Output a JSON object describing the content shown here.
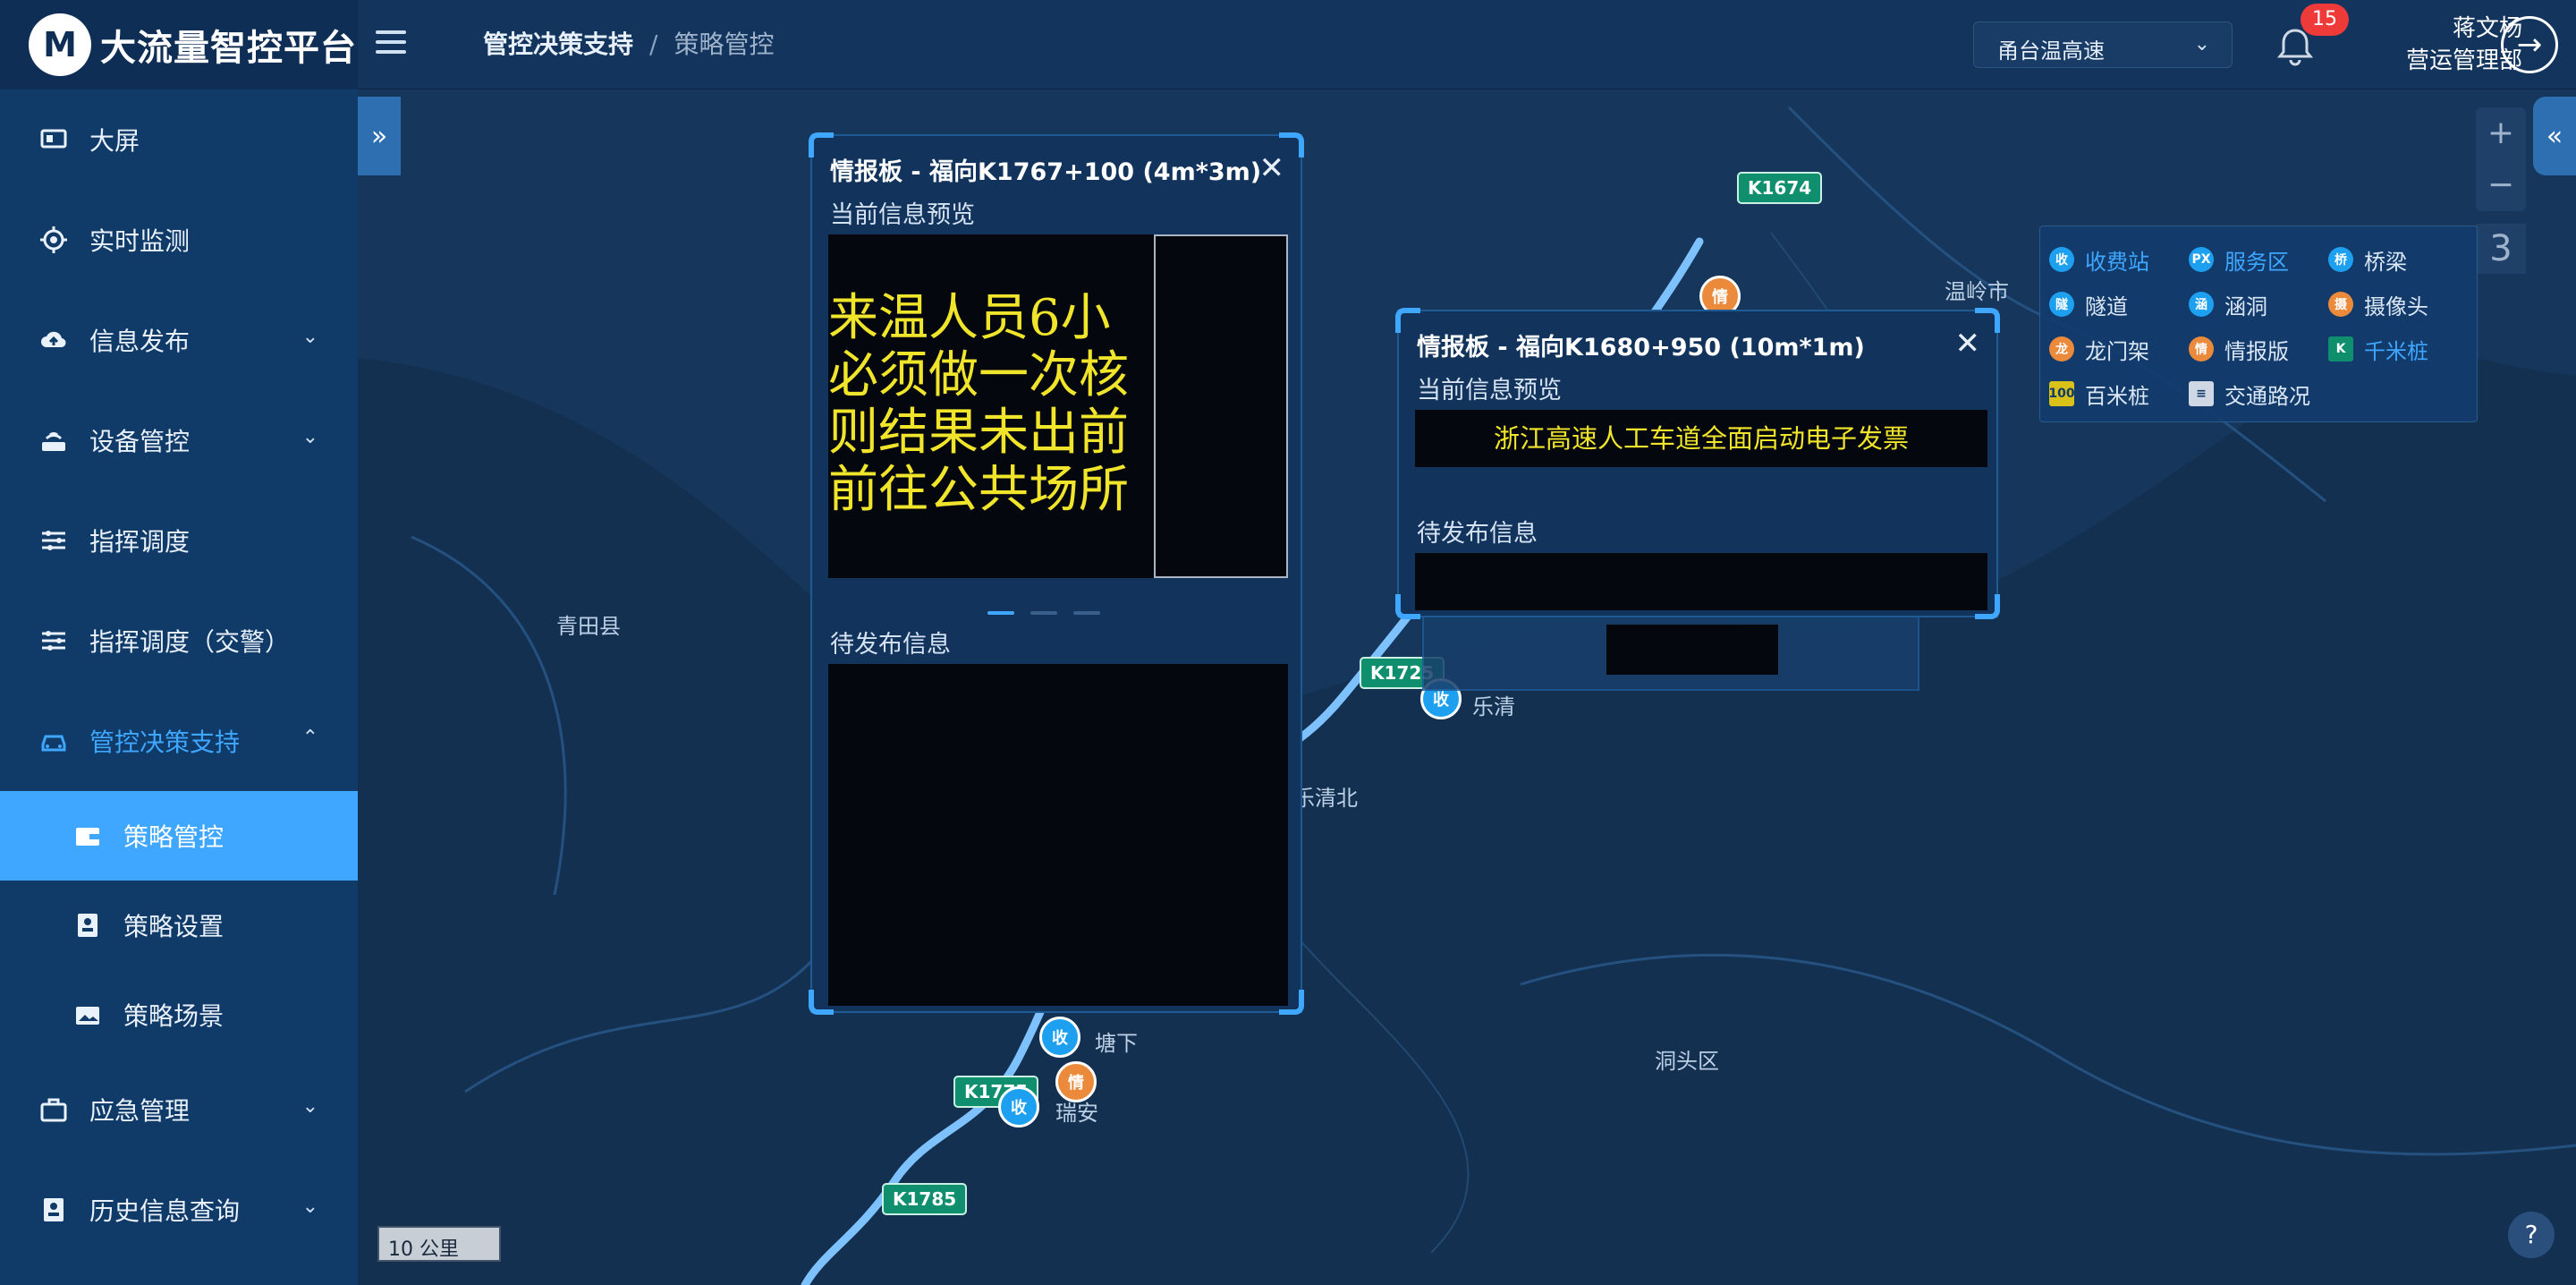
{
  "app": {
    "title": "大流量智控平台",
    "logo_mark": "M"
  },
  "breadcrumb": {
    "parent": "管控决策支持",
    "separator": "/",
    "current": "策略管控"
  },
  "route_select": {
    "value": "甬台温高速"
  },
  "notifications": {
    "count": "15"
  },
  "user": {
    "name": "蒋文杨",
    "dept": "营运管理部"
  },
  "sidebar": {
    "items": [
      {
        "label": "大屏"
      },
      {
        "label": "实时监测"
      },
      {
        "label": "信息发布"
      },
      {
        "label": "设备管控"
      },
      {
        "label": "指挥调度"
      },
      {
        "label": "指挥调度（交警）"
      },
      {
        "label": "管控决策支持"
      },
      {
        "label": "应急管理"
      },
      {
        "label": "历史信息查询"
      }
    ],
    "subitems": [
      {
        "label": "策略管控"
      },
      {
        "label": "策略设置"
      },
      {
        "label": "策略场景"
      }
    ]
  },
  "legend": [
    {
      "label": "收费站",
      "icon": "toll-station-icon",
      "color": "#1ea0f0",
      "active": true
    },
    {
      "label": "服务区",
      "icon": "service-area-icon",
      "color": "#1ea0f0",
      "active": true
    },
    {
      "label": "桥梁",
      "icon": "bridge-icon",
      "color": "#1ea0f0",
      "active": false
    },
    {
      "label": "隧道",
      "icon": "tunnel-icon",
      "color": "#1ea0f0",
      "active": false
    },
    {
      "label": "涵洞",
      "icon": "culvert-icon",
      "color": "#1ea0f0",
      "active": false
    },
    {
      "label": "摄像头",
      "icon": "camera-icon",
      "color": "#ec8a3c",
      "active": false
    },
    {
      "label": "龙门架",
      "icon": "gantry-icon",
      "color": "#ec8a3c",
      "active": false
    },
    {
      "label": "情报版",
      "icon": "info-board-icon",
      "color": "#ec8a3c",
      "active": false
    },
    {
      "label": "千米桩",
      "icon": "km-marker-icon",
      "color": "#0f8f6e",
      "active": true
    },
    {
      "label": "百米桩",
      "icon": "hm-marker-icon",
      "color": "#d8c21a",
      "active": false
    },
    {
      "label": "交通路况",
      "icon": "traffic-light-icon",
      "color": "#cfd8e4",
      "active": false
    }
  ],
  "map": {
    "zoom_level": "3",
    "scale_label": "10 公里",
    "places": [
      "温岭市",
      "青田县",
      "乐清",
      "乐清北",
      "塘下",
      "瑞安",
      "洞头区"
    ],
    "km_markers": [
      "K1674",
      "K1725",
      "K1775",
      "K1785"
    ]
  },
  "popup1": {
    "title": "情报板 - 福向K1767+100 (4m*3m)",
    "preview_label": "当前信息预览",
    "led_lines": [
      "来温人员6小",
      "必须做一次核",
      "则结果未出前",
      "前往公共场所"
    ],
    "pending_label": "待发布信息"
  },
  "popup2": {
    "title": "情报板 - 福向K1680+950 (10m*1m)",
    "preview_label": "当前信息预览",
    "led_text": "浙江高速人工车道全面启动电子发票",
    "pending_label": "待发布信息"
  },
  "colors": {
    "accent": "#3fa7ff",
    "sidebar_bg": "#103a68",
    "map_bg": "#16365c",
    "led_yellow": "#f0e52a"
  }
}
